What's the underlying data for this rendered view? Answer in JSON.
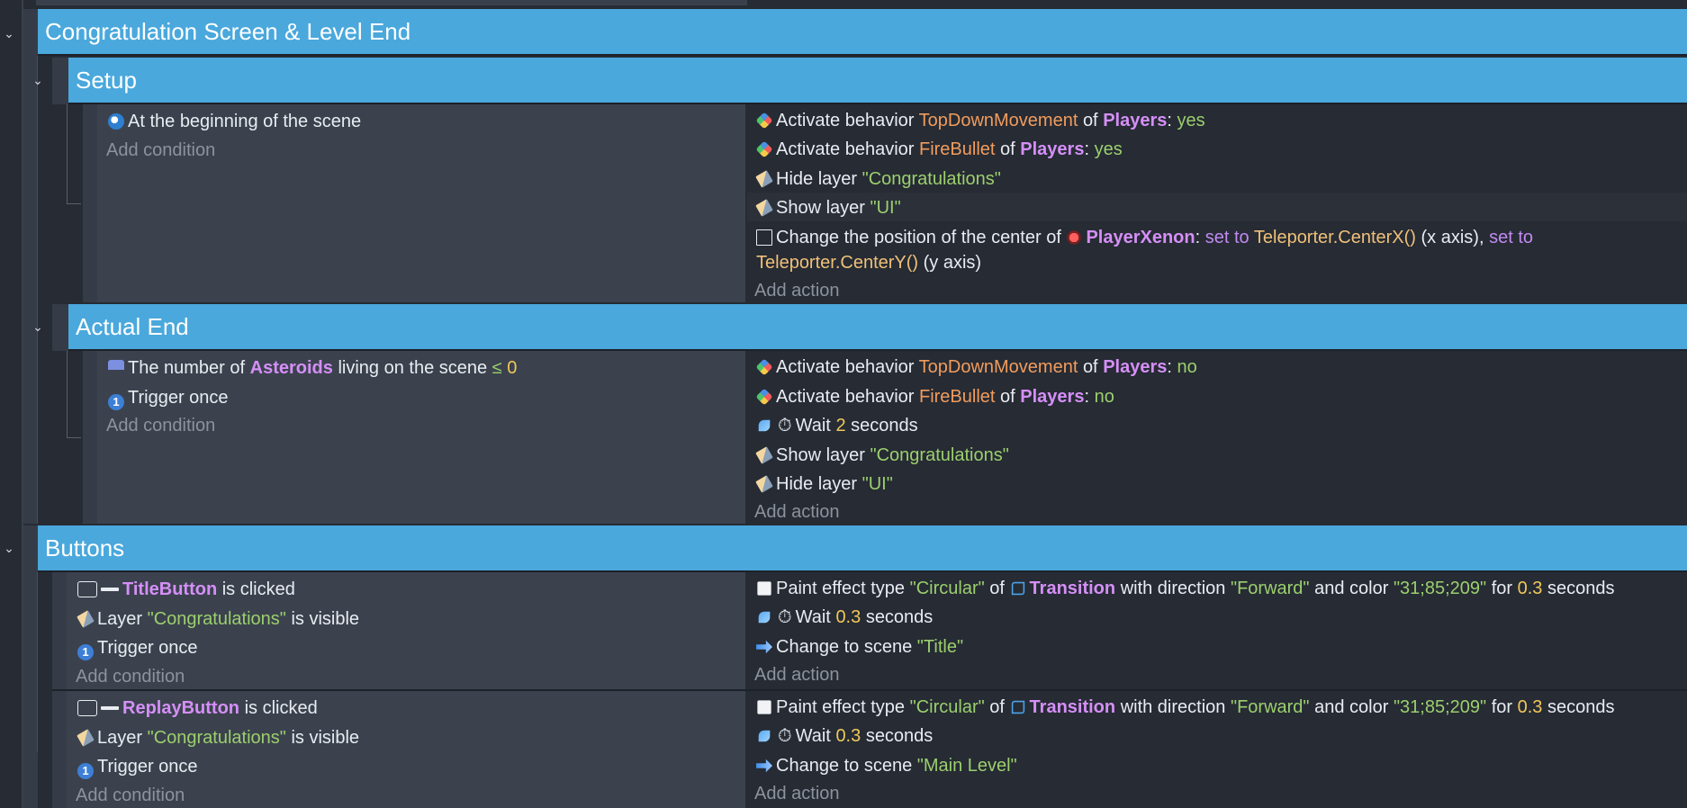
{
  "groups": {
    "congratulation": {
      "title": "Congratulation Screen & Level End"
    },
    "setup": {
      "title": "Setup"
    },
    "actual_end": {
      "title": "Actual End"
    },
    "buttons": {
      "title": "Buttons"
    }
  },
  "common": {
    "add_condition": "Add condition",
    "add_action": "Add action"
  },
  "setup_event": {
    "conditions": [
      "At the beginning of the scene"
    ],
    "actions": {
      "a1": {
        "pre": "Activate behavior",
        "behavior": "TopDownMovement",
        "of": "of",
        "object": "Players",
        "colon": ":",
        "value": "yes"
      },
      "a2": {
        "pre": "Activate behavior",
        "behavior": "FireBullet",
        "of": "of",
        "object": "Players",
        "colon": ":",
        "value": "yes"
      },
      "a3": {
        "pre": "Hide layer",
        "value": "\"Congratulations\""
      },
      "a4": {
        "pre": "Show layer",
        "value": "\"UI\""
      },
      "a5": {
        "pre": "Change the position of the center of",
        "object": "PlayerXenon",
        "colon": ":",
        "set_to_1": "set to",
        "expr_1": "Teleporter.CenterX()",
        "axis_1": "(x axis),",
        "set_to_2": "set to",
        "expr_2": "Teleporter.CenterY()",
        "axis_2": "(y axis)"
      }
    }
  },
  "actual_end_event": {
    "conditions": {
      "c1": {
        "pre": "The number of",
        "object": "Asteroids",
        "post": "living on the scene",
        "op": "≤",
        "value": "0"
      },
      "c2": {
        "text": "Trigger once"
      }
    },
    "actions": {
      "a1": {
        "pre": "Activate behavior",
        "behavior": "TopDownMovement",
        "of": "of",
        "object": "Players",
        "colon": ":",
        "value": "no"
      },
      "a2": {
        "pre": "Activate behavior",
        "behavior": "FireBullet",
        "of": "of",
        "object": "Players",
        "colon": ":",
        "value": "no"
      },
      "a3": {
        "pre": "Wait",
        "value": "2",
        "post": "seconds"
      },
      "a4": {
        "pre": "Show layer",
        "value": "\"Congratulations\""
      },
      "a5": {
        "pre": "Hide layer",
        "value": "\"UI\""
      }
    }
  },
  "title_button_event": {
    "conditions": {
      "c1": {
        "object": "TitleButton",
        "post": "is clicked"
      },
      "c2": {
        "pre": "Layer",
        "value": "\"Congratulations\"",
        "post": "is visible"
      },
      "c3": {
        "text": "Trigger once"
      }
    },
    "actions": {
      "a1": {
        "pre": "Paint effect type",
        "type": "\"Circular\"",
        "of": "of",
        "object": "Transition",
        "mid": "with direction",
        "dir": "\"Forward\"",
        "and": "and color",
        "color": "\"31;85;209\"",
        "for": "for",
        "dur": "0.3",
        "post": "seconds"
      },
      "a2": {
        "pre": "Wait",
        "value": "0.3",
        "post": "seconds"
      },
      "a3": {
        "pre": "Change to scene",
        "value": "\"Title\""
      }
    }
  },
  "replay_button_event": {
    "conditions": {
      "c1": {
        "object": "ReplayButton",
        "post": "is clicked"
      },
      "c2": {
        "pre": "Layer",
        "value": "\"Congratulations\"",
        "post": "is visible"
      },
      "c3": {
        "text": "Trigger once"
      }
    },
    "actions": {
      "a1": {
        "pre": "Paint effect type",
        "type": "\"Circular\"",
        "of": "of",
        "object": "Transition",
        "mid": "with direction",
        "dir": "\"Forward\"",
        "and": "and color",
        "color": "\"31;85;209\"",
        "for": "for",
        "dur": "0.3",
        "post": "seconds"
      },
      "a2": {
        "pre": "Wait",
        "value": "0.3",
        "post": "seconds"
      },
      "a3": {
        "pre": "Change to scene",
        "value": "\"Main Level\""
      }
    }
  },
  "colors": {
    "group_header": "#4aa8dc",
    "object": "#d58ff7",
    "behavior": "#f29c5c",
    "string": "#9ccf6d",
    "number": "#f0c85a",
    "background": "#262b34",
    "condition_panel": "#3b424e"
  },
  "icons": {
    "collapse": "chevron-down-icon",
    "scene_start": "scene-start-icon",
    "behavior": "behavior-icon",
    "layer": "layer-icon",
    "position": "position-icon",
    "object_count": "object-count-icon",
    "trigger_once": "trigger-once-icon",
    "wait": "wait-icon",
    "stopwatch": "stopwatch-icon",
    "paint_effect": "paint-effect-icon",
    "change_scene": "change-scene-icon",
    "button": "button-icon"
  }
}
